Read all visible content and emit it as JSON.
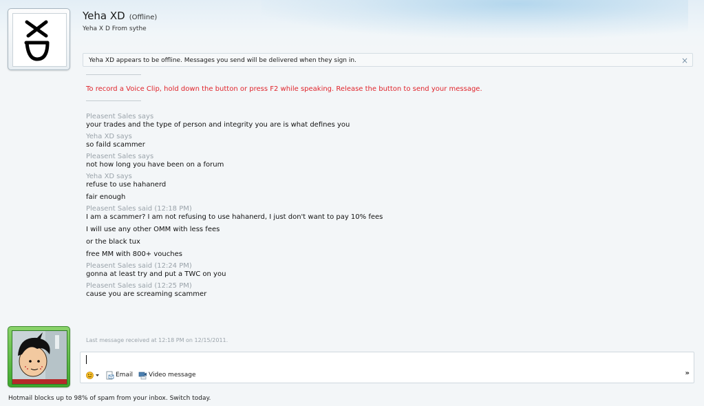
{
  "contact": {
    "name": "Yeha XD",
    "status": "(Offline)",
    "personal_message": "Yeha X D From sythe"
  },
  "notice": {
    "text": "Yeha XD appears to be offline. Messages you send will be delivered when they sign in.",
    "close_glyph": "×"
  },
  "voice_tip": "To record a Voice Clip, hold down the button or press F2 while speaking. Release the button to send your message.",
  "conversation": [
    {
      "sender": "Pleasent Sales says",
      "messages": [
        "your trades and the type of person and integrity you are is what defines you"
      ]
    },
    {
      "sender": "Yeha XD says",
      "messages": [
        "so faild scammer"
      ]
    },
    {
      "sender": "Pleasent Sales says",
      "messages": [
        "not how long you have been on a forum"
      ]
    },
    {
      "sender": "Yeha XD says",
      "messages": [
        "refuse to use hahanerd",
        "fair enough"
      ]
    },
    {
      "sender": "Pleasent Sales said (12:18 PM)",
      "messages": [
        "I am a scammer? I am not refusing to use hahanerd, I just don't want to pay 10% fees",
        "I will use any other OMM with less fees",
        "or the black tux",
        "free MM with 800+ vouches"
      ]
    },
    {
      "sender": "Pleasent Sales said (12:24 PM)",
      "messages": [
        "gonna at least try and put a TWC on you"
      ]
    },
    {
      "sender": "Pleasent Sales said (12:25 PM)",
      "messages": [
        "cause you are screaming scammer"
      ]
    }
  ],
  "last_received": "Last message received at 12:18 PM on 12/15/2011.",
  "toolbar": {
    "email_label": "Email",
    "video_label": "Video message",
    "more_glyph": "»"
  },
  "ad_text": "Hotmail blocks up to 98% of spam from your inbox. Switch today.",
  "icons": [
    "emoticon-icon",
    "dropdown-arrow-icon",
    "email-icon",
    "video-message-icon",
    "close-icon",
    "more-chevron-icon"
  ],
  "colors": {
    "voice_tip": "#e0242b",
    "sender": "#9aa3aa",
    "user_frame": "#3ea82e"
  }
}
